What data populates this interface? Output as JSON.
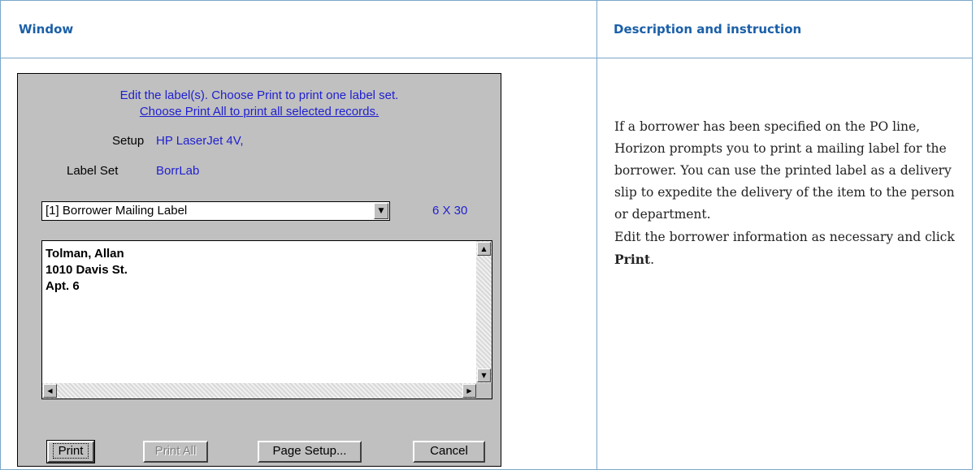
{
  "header": {
    "window_label": "Window",
    "description_label": "Description and instruction"
  },
  "dialog": {
    "instruction_line1": "Edit the label(s). Choose Print to print one label set.",
    "instruction_line2": "Choose Print All to print all selected records.",
    "setup_label": "Setup",
    "setup_value": "HP LaserJet 4V,",
    "labelset_label": "Label Set",
    "labelset_value": "BorrLab",
    "combo_value": "[1] Borrower Mailing Label",
    "label_size": "6  X  30",
    "edit_lines": [
      "Tolman, Allan",
      "1010 Davis St.",
      "Apt. 6"
    ],
    "buttons": {
      "print": "Print",
      "print_all": "Print All",
      "page_setup": "Page Setup...",
      "cancel": "Cancel"
    }
  },
  "description": {
    "para1": "If a borrower has been specified on the PO line, Horizon prompts you to print a mailing label for the borrower. You can use the printed label as a delivery slip to expedite the delivery of the item to the person or department.",
    "para2_prefix": "Edit the borrower information as necessary and click ",
    "para2_bold": "Print",
    "para2_suffix": "."
  }
}
